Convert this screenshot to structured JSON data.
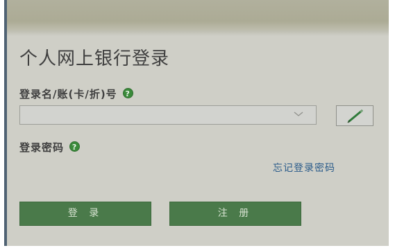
{
  "login": {
    "title": "个人网上银行登录",
    "username_label": "登录名/账(卡/折)号",
    "username_value": "",
    "password_label": "登录密码",
    "forgot_password": "忘记登录密码",
    "login_button": "登 录",
    "register_button": "注 册",
    "help_glyph": "?"
  },
  "icons": {
    "help": "help-question-icon",
    "dropdown": "chevron-down-icon",
    "keyboard": "pen-icon"
  },
  "colors": {
    "accent_green": "#4a7a4a",
    "link_blue": "#2a5b8a",
    "help_green": "#3a8a3a"
  }
}
